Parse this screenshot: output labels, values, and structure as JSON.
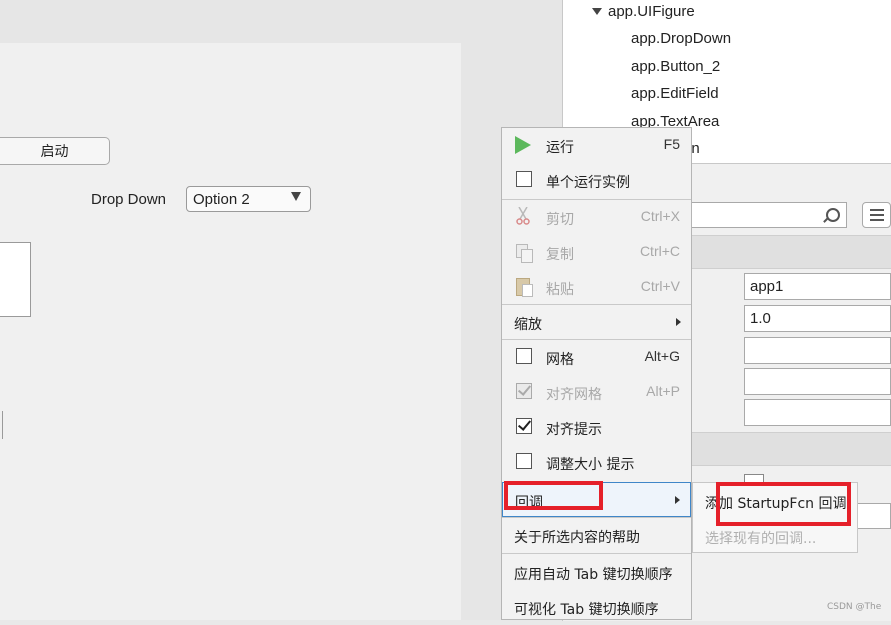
{
  "designer": {
    "start_button_label": "启动",
    "dropdown_label": "Drop Down",
    "dropdown_value": "Option 2"
  },
  "component_browser": {
    "root": "app.UIFigure",
    "items": [
      "app.DropDown",
      "app.Button_2",
      "app.EditField",
      "app.TextArea",
      "on"
    ]
  },
  "inspector": {
    "fields": [
      "app1",
      "1.0",
      "",
      "",
      ""
    ]
  },
  "context_menu": {
    "run": {
      "label": "运行",
      "shortcut": "F5"
    },
    "single_instance": {
      "label": "单个运行实例",
      "checked": false
    },
    "cut": {
      "label": "剪切",
      "shortcut": "Ctrl+X",
      "enabled": false
    },
    "copy": {
      "label": "复制",
      "shortcut": "Ctrl+C",
      "enabled": false
    },
    "paste": {
      "label": "粘贴",
      "shortcut": "Ctrl+V",
      "enabled": false
    },
    "zoom": {
      "label": "缩放"
    },
    "grid": {
      "label": "网格",
      "shortcut": "Alt+G",
      "checked": false
    },
    "snap_grid": {
      "label": "对齐网格",
      "shortcut": "Alt+P",
      "checked": true,
      "enabled": false
    },
    "align_hints": {
      "label": "对齐提示",
      "checked": true
    },
    "resize_hints": {
      "label": "调整大小 提示",
      "checked": false
    },
    "callback": {
      "label": "回调"
    },
    "help": {
      "label": "关于所选内容的帮助"
    },
    "apply_tab_order": {
      "label": "应用自动 Tab 键切换顺序"
    },
    "visualize_tab_order": {
      "label": "可视化 Tab 键切换顺序"
    }
  },
  "callback_submenu": {
    "add_startup": "添加 StartupFcn 回调",
    "select_existing": "选择现有的回调..."
  },
  "watermark": "CSDN @The",
  "colors": {
    "highlight_red": "#e5202a",
    "run_green": "#5cb85c",
    "selection_blue": "#3f86c8"
  }
}
